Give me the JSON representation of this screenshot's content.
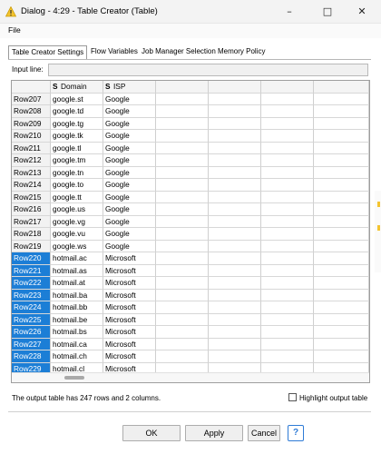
{
  "window": {
    "title": "Dialog - 4:29 - Table Creator (Table)",
    "controls": {
      "minimize": "–",
      "maximize": "□",
      "close": "✕"
    }
  },
  "menu": {
    "file": "File"
  },
  "tabs": [
    {
      "label": "Table Creator Settings",
      "active": true
    },
    {
      "label": "Flow Variables",
      "active": false
    },
    {
      "label": "Job Manager Selection",
      "active": false
    },
    {
      "label": "Memory Policy",
      "active": false
    }
  ],
  "input_line": {
    "label": "Input line:",
    "value": ""
  },
  "table": {
    "columns": [
      {
        "type": "S",
        "name": "Domain"
      },
      {
        "type": "S",
        "name": "ISP"
      }
    ],
    "rows": [
      {
        "id": "Row207",
        "domain": "google.st",
        "isp": "Google",
        "selected": false
      },
      {
        "id": "Row208",
        "domain": "google.td",
        "isp": "Google",
        "selected": false
      },
      {
        "id": "Row209",
        "domain": "google.tg",
        "isp": "Google",
        "selected": false
      },
      {
        "id": "Row210",
        "domain": "google.tk",
        "isp": "Google",
        "selected": false
      },
      {
        "id": "Row211",
        "domain": "google.tl",
        "isp": "Google",
        "selected": false
      },
      {
        "id": "Row212",
        "domain": "google.tm",
        "isp": "Google",
        "selected": false
      },
      {
        "id": "Row213",
        "domain": "google.tn",
        "isp": "Google",
        "selected": false
      },
      {
        "id": "Row214",
        "domain": "google.to",
        "isp": "Google",
        "selected": false
      },
      {
        "id": "Row215",
        "domain": "google.tt",
        "isp": "Google",
        "selected": false
      },
      {
        "id": "Row216",
        "domain": "google.us",
        "isp": "Google",
        "selected": false
      },
      {
        "id": "Row217",
        "domain": "google.vg",
        "isp": "Google",
        "selected": false
      },
      {
        "id": "Row218",
        "domain": "google.vu",
        "isp": "Google",
        "selected": false
      },
      {
        "id": "Row219",
        "domain": "google.ws",
        "isp": "Google",
        "selected": false
      },
      {
        "id": "Row220",
        "domain": "hotmail.ac",
        "isp": "Microsoft",
        "selected": true
      },
      {
        "id": "Row221",
        "domain": "hotmail.as",
        "isp": "Microsoft",
        "selected": true
      },
      {
        "id": "Row222",
        "domain": "hotmail.at",
        "isp": "Microsoft",
        "selected": true
      },
      {
        "id": "Row223",
        "domain": "hotmail.ba",
        "isp": "Microsoft",
        "selected": true
      },
      {
        "id": "Row224",
        "domain": "hotmail.bb",
        "isp": "Microsoft",
        "selected": true
      },
      {
        "id": "Row225",
        "domain": "hotmail.be",
        "isp": "Microsoft",
        "selected": true
      },
      {
        "id": "Row226",
        "domain": "hotmail.bs",
        "isp": "Microsoft",
        "selected": true
      },
      {
        "id": "Row227",
        "domain": "hotmail.ca",
        "isp": "Microsoft",
        "selected": true
      },
      {
        "id": "Row228",
        "domain": "hotmail.ch",
        "isp": "Microsoft",
        "selected": true
      },
      {
        "id": "Row229",
        "domain": "hotmail.cl",
        "isp": "Microsoft",
        "selected": true
      }
    ]
  },
  "status": {
    "text": "The output table has 247 rows and 2 columns.",
    "highlight_label": "Highlight output table",
    "highlight_checked": false
  },
  "buttons": {
    "ok": "OK",
    "apply": "Apply",
    "cancel": "Cancel",
    "help": "?"
  },
  "icons": {
    "title": "knime-node-warning-icon",
    "help": "help-icon"
  },
  "colors": {
    "selected_row": "#1c7ed6",
    "accent": "#2f7bd6",
    "warning": "#f4c430"
  }
}
